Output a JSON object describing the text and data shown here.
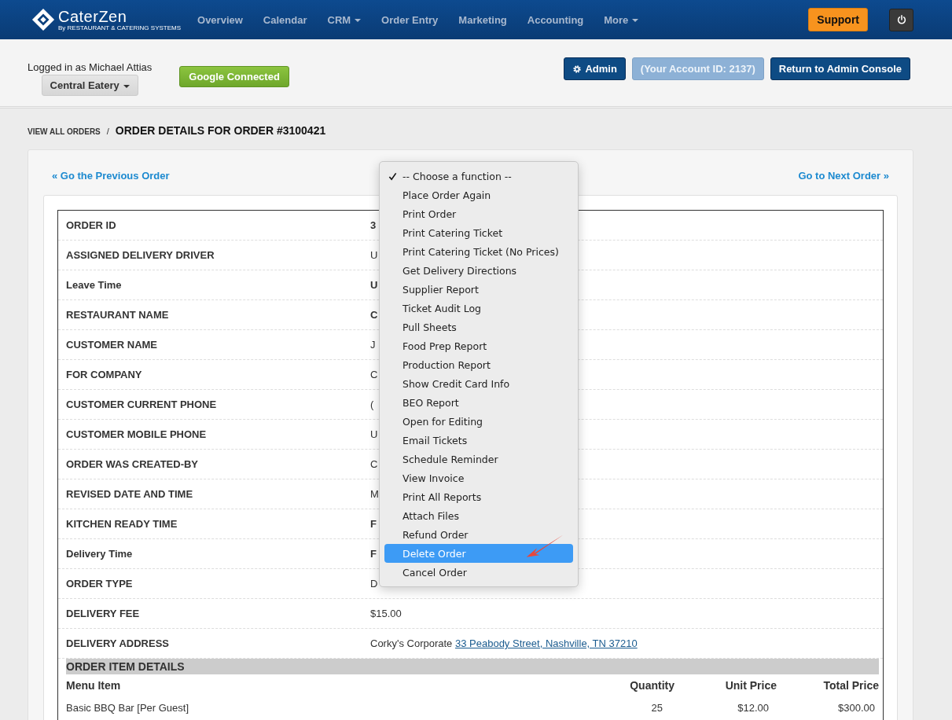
{
  "brand": {
    "name": "CaterZen",
    "tagline": "By RESTAURANT & CATERING SYSTEMS"
  },
  "nav": [
    {
      "label": "Overview",
      "dropdown": false
    },
    {
      "label": "Calendar",
      "dropdown": false
    },
    {
      "label": "CRM",
      "dropdown": true
    },
    {
      "label": "Order Entry",
      "dropdown": false
    },
    {
      "label": "Marketing",
      "dropdown": false
    },
    {
      "label": "Accounting",
      "dropdown": false
    },
    {
      "label": "More",
      "dropdown": true
    }
  ],
  "support_button": "Support",
  "account": {
    "logged_in": "Logged in as Michael Attias",
    "location": "Central Eatery",
    "google": "Google Connected"
  },
  "admin_buttons": [
    {
      "label": "Admin",
      "kind": "admin"
    },
    {
      "label": "(Your Account ID: 2137)",
      "kind": "disabled"
    },
    {
      "label": "Return to Admin Console",
      "kind": "primary"
    }
  ],
  "breadcrumb": {
    "link": "VIEW ALL ORDERS",
    "separator": "/",
    "title": "ORDER DETAILS FOR ORDER #3100421"
  },
  "prev_link": "« Go the Previous Order",
  "next_link": "Go to Next Order »",
  "details": [
    {
      "label": "ORDER ID",
      "value": "3",
      "bold": true
    },
    {
      "label": "ASSIGNED DELIVERY DRIVER",
      "value": "U",
      "bold": false
    },
    {
      "label": "Leave Time",
      "value": "U",
      "bold": true
    },
    {
      "label": "RESTAURANT NAME",
      "value": "C",
      "bold": true
    },
    {
      "label": "CUSTOMER NAME",
      "value": "J",
      "bold": false
    },
    {
      "label": "FOR COMPANY",
      "value": "C",
      "bold": false
    },
    {
      "label": "CUSTOMER CURRENT PHONE",
      "value": "(",
      "bold": false
    },
    {
      "label": "CUSTOMER MOBILE PHONE",
      "value": "U",
      "bold": false
    },
    {
      "label": "ORDER WAS CREATED-BY",
      "value": "C",
      "bold": false
    },
    {
      "label": "REVISED DATE AND TIME",
      "value": "M",
      "bold": false
    },
    {
      "label": "KITCHEN READY TIME",
      "value": "F",
      "bold": true
    },
    {
      "label": "Delivery Time",
      "value": "F",
      "bold": true
    },
    {
      "label": "ORDER TYPE",
      "value": "D",
      "bold": false
    },
    {
      "label": "DELIVERY FEE",
      "value": "$15.00",
      "bold": false
    },
    {
      "label": "DELIVERY ADDRESS",
      "value": "Corky's Corporate",
      "link": "33 Peabody Street, Nashville, TN 37210",
      "bold": false
    }
  ],
  "items_section": {
    "title": "ORDER ITEM DETAILS",
    "columns": [
      "Menu Item",
      "Quantity",
      "Unit Price",
      "Total Price"
    ],
    "rows": [
      [
        "Basic BBQ Bar [Per Guest]",
        "25",
        "$12.00",
        "$300.00"
      ]
    ]
  },
  "function_menu": [
    {
      "label": "-- Choose a function --",
      "selected": true,
      "highlighted": false
    },
    {
      "label": "Place Order Again",
      "selected": false,
      "highlighted": false
    },
    {
      "label": "Print Order",
      "selected": false,
      "highlighted": false
    },
    {
      "label": "Print Catering Ticket",
      "selected": false,
      "highlighted": false
    },
    {
      "label": "Print Catering Ticket (No Prices)",
      "selected": false,
      "highlighted": false
    },
    {
      "label": "Get Delivery Directions",
      "selected": false,
      "highlighted": false
    },
    {
      "label": "Supplier Report",
      "selected": false,
      "highlighted": false
    },
    {
      "label": "Ticket Audit Log",
      "selected": false,
      "highlighted": false
    },
    {
      "label": "Pull Sheets",
      "selected": false,
      "highlighted": false
    },
    {
      "label": "Food Prep Report",
      "selected": false,
      "highlighted": false
    },
    {
      "label": "Production Report",
      "selected": false,
      "highlighted": false
    },
    {
      "label": "Show Credit Card Info",
      "selected": false,
      "highlighted": false
    },
    {
      "label": "BEO Report",
      "selected": false,
      "highlighted": false
    },
    {
      "label": "Open for Editing",
      "selected": false,
      "highlighted": false
    },
    {
      "label": "Email Tickets",
      "selected": false,
      "highlighted": false
    },
    {
      "label": "Schedule Reminder",
      "selected": false,
      "highlighted": false
    },
    {
      "label": "View Invoice",
      "selected": false,
      "highlighted": false
    },
    {
      "label": "Print All Reports",
      "selected": false,
      "highlighted": false
    },
    {
      "label": "Attach Files",
      "selected": false,
      "highlighted": false
    },
    {
      "label": "Refund Order",
      "selected": false,
      "highlighted": false
    },
    {
      "label": "Delete Order",
      "selected": false,
      "highlighted": true
    },
    {
      "label": "Cancel Order",
      "selected": false,
      "highlighted": false
    }
  ]
}
